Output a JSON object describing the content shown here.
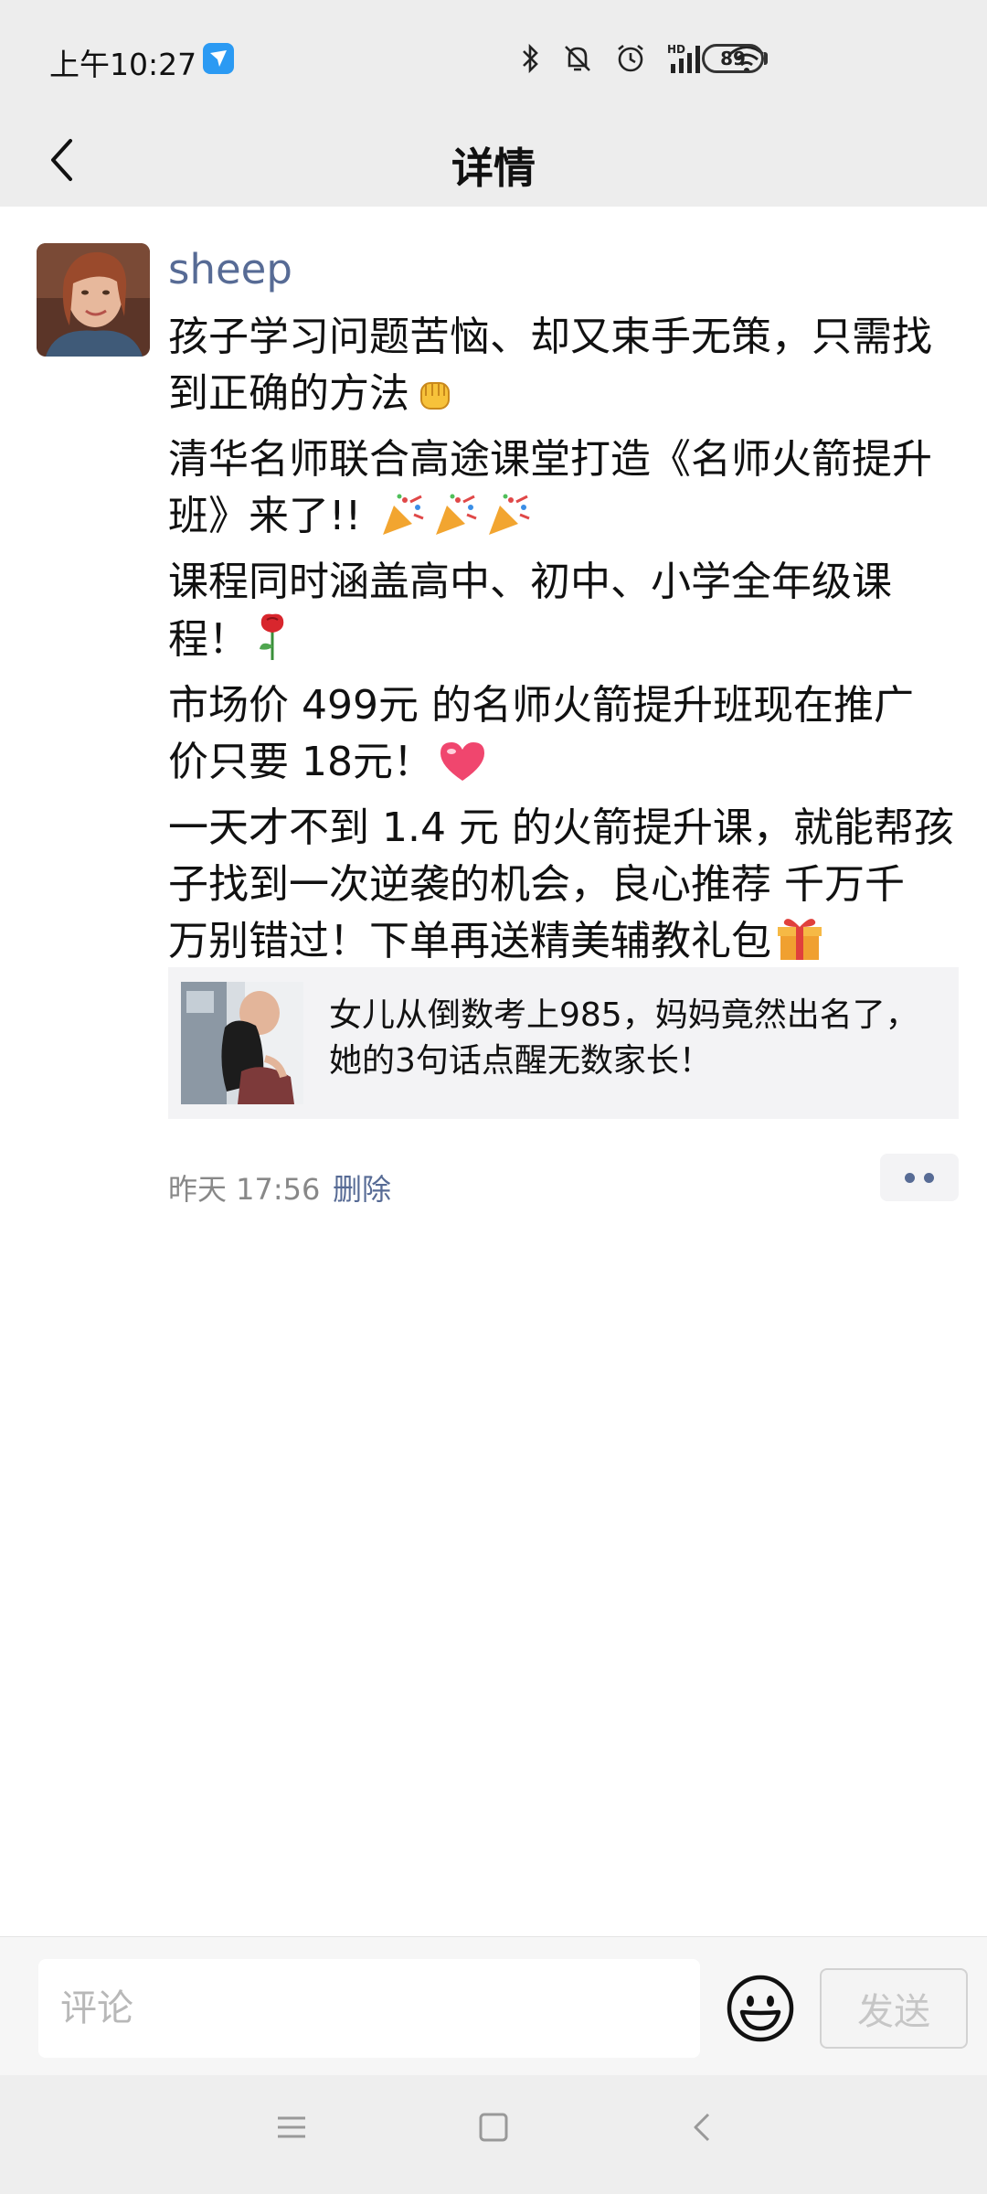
{
  "status_bar": {
    "time": "上午10:27",
    "battery": "89",
    "icons": [
      "bluetooth-icon",
      "mute-icon",
      "alarm-icon",
      "hd-signal-icon",
      "wifi-icon",
      "battery-icon"
    ]
  },
  "nav": {
    "title": "详情"
  },
  "post": {
    "author": "sheep",
    "lines": [
      "孩子学习问题苦恼、却又束手无策，只需找",
      "到正确的方法",
      "清华名师联合高途课堂打造《名师火箭提升",
      "班》来了!! ",
      "课程同时涵盖高中、初中、小学全年级课",
      "程！",
      "市场价 499元 的名师火箭提升班现在推广",
      "价只要 18元！",
      "一天才不到 1.4 元 的火箭提升课，就能帮孩",
      "子找到一次逆袭的机会，良心推荐 千万千",
      "万别错过！下单再送精美辅教礼包"
    ],
    "emojis": [
      "fist-emoji",
      "party-popper-emoji",
      "rose-emoji",
      "heart-emoji",
      "gift-emoji"
    ],
    "link_card": {
      "title_lines": [
        "女儿从倒数考上985，妈妈竟然出名了，",
        "她的3句话点醒无数家长！"
      ]
    },
    "time": "昨天 17:56",
    "delete_label": "删除"
  },
  "comment_bar": {
    "placeholder": "评论",
    "send_label": "发送"
  },
  "colors": {
    "link": "#576b95",
    "header_bg": "#ededed"
  }
}
